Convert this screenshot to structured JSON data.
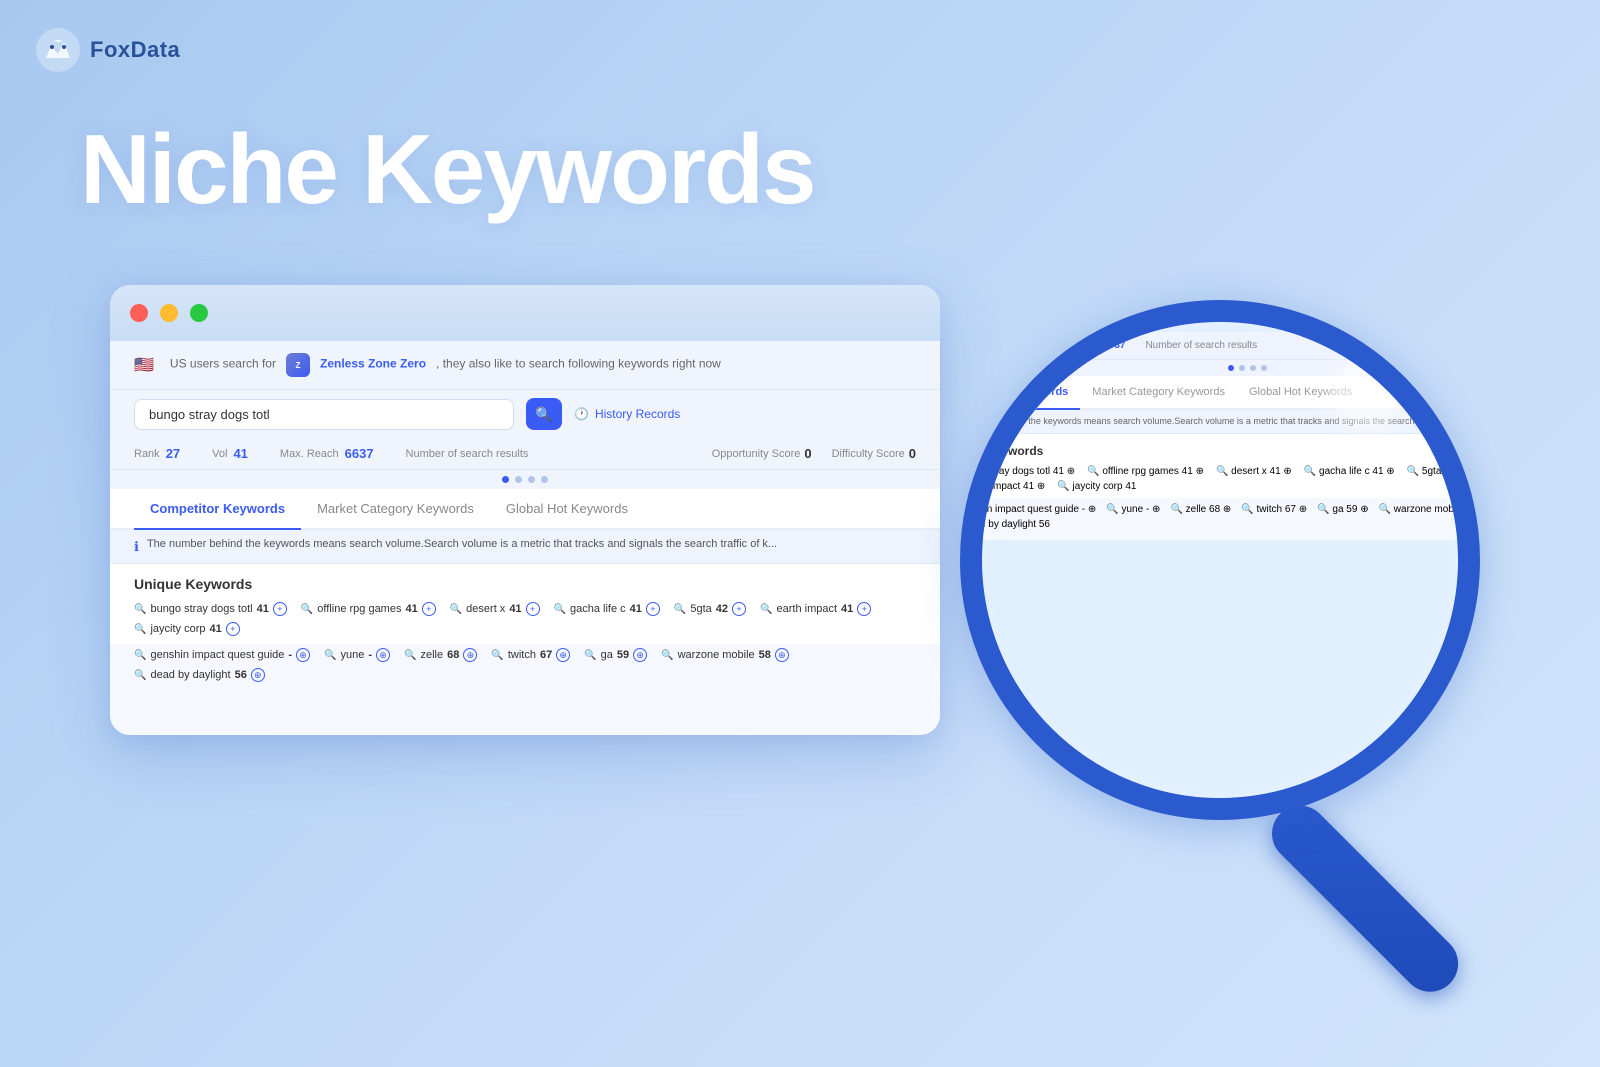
{
  "header": {
    "logo_text": "FoxData"
  },
  "hero": {
    "title": "Niche Keywords"
  },
  "browser": {
    "search_description_pre": "US  users search for",
    "app_name": "Zenless Zone Zero",
    "search_description_post": ", they also like to search following keywords right now",
    "search_value": "bungo stray dogs totl",
    "search_placeholder": "bungo stray dogs totl",
    "history_label": "History Records",
    "stats": {
      "rank_label": "Rank",
      "rank_value": "27",
      "vol_label": "Vol",
      "vol_value": "41",
      "max_reach_label": "Max. Reach",
      "max_reach_value": "6637",
      "results_label": "Number of search results",
      "opportunity_label": "Opportunity Score",
      "opportunity_value": "0",
      "difficulty_label": "Difficulty Score",
      "difficulty_value": "0"
    },
    "tabs": [
      {
        "label": "Competitor Keywords",
        "active": true
      },
      {
        "label": "Market Category Keywords",
        "active": false
      },
      {
        "label": "Global Hot Keywords",
        "active": false
      }
    ],
    "info_notice": "The number behind the keywords means search volume.Search volume is a metric that tracks and signals the search traffic of k...",
    "unique_keywords_label": "Unique Keywords",
    "keywords_row1": [
      {
        "name": "bungo stray dogs totl",
        "value": "41"
      },
      {
        "name": "offline rpg games",
        "value": "41"
      },
      {
        "name": "desert x",
        "value": "41"
      },
      {
        "name": "gacha life c",
        "value": "41"
      },
      {
        "name": "5gta",
        "value": "42"
      },
      {
        "name": "earth impact",
        "value": "41"
      },
      {
        "name": "jaycity corp",
        "value": "41"
      }
    ],
    "keywords_row2": [
      {
        "name": "genshin impact quest guide",
        "value": "-"
      },
      {
        "name": "yune",
        "value": "-"
      },
      {
        "name": "zelle",
        "value": "68"
      },
      {
        "name": "twitch",
        "value": "67"
      },
      {
        "name": "ga",
        "value": "59"
      },
      {
        "name": "warzone mobile",
        "value": "58"
      },
      {
        "name": "dead by daylight",
        "value": "56"
      }
    ]
  },
  "magnifier": {
    "lens_content_visible": true
  }
}
